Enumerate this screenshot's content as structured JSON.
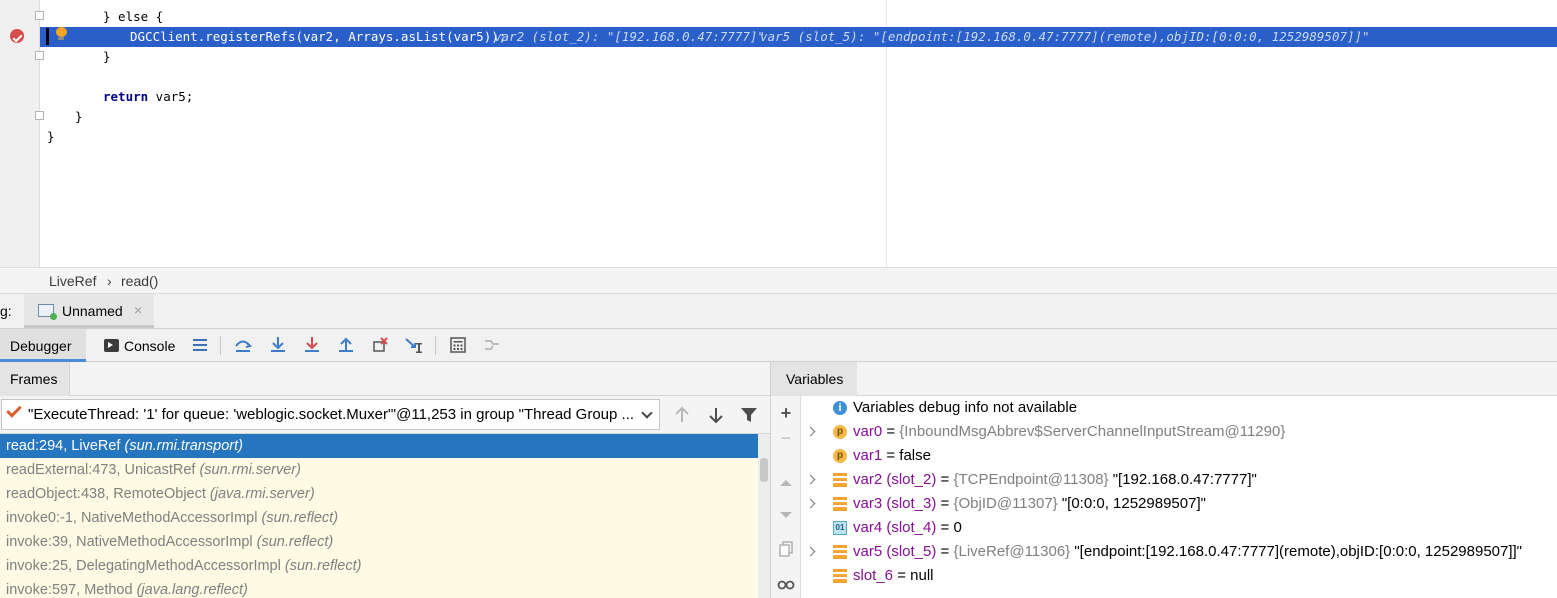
{
  "editor": {
    "lines": {
      "else": "} else {",
      "call": "DGCClient.registerRefs(var2, Arrays.asList(var5));",
      "inline_var2": "var2 (slot_2): \"[192.168.0.47:7777]\"",
      "inline_var5": "var5 (slot_5): \"[endpoint:[192.168.0.47:7777](remote),objID:[0:0:0, 1252989507]]\"",
      "close_else": "}",
      "return_kw": "return",
      "return_rest": " var5;",
      "close_method": "}",
      "close_class": "}"
    }
  },
  "breadcrumb": {
    "class": "LiveRef",
    "sep": "›",
    "method": "read()"
  },
  "debug_tabbar": {
    "label": "g:",
    "session": "Unnamed",
    "close": "×"
  },
  "toolbar": {
    "debugger": "Debugger",
    "console": "Console"
  },
  "frames": {
    "header": "Frames",
    "thread": "\"ExecuteThread: '1' for queue: 'weblogic.socket.Muxer'\"@11,253 in group \"Thread Group ...",
    "items": [
      {
        "loc": "read:294, LiveRef ",
        "pkg": "(sun.rmi.transport)"
      },
      {
        "loc": "readExternal:473, UnicastRef ",
        "pkg": "(sun.rmi.server)"
      },
      {
        "loc": "readObject:438, RemoteObject ",
        "pkg": "(java.rmi.server)"
      },
      {
        "loc": "invoke0:-1, NativeMethodAccessorImpl ",
        "pkg": "(sun.reflect)"
      },
      {
        "loc": "invoke:39, NativeMethodAccessorImpl ",
        "pkg": "(sun.reflect)"
      },
      {
        "loc": "invoke:25, DelegatingMethodAccessorImpl ",
        "pkg": "(sun.reflect)"
      },
      {
        "loc": "invoke:597, Method ",
        "pkg": "(java.lang.reflect)"
      }
    ]
  },
  "variables": {
    "header": "Variables",
    "info": "Variables debug info not available",
    "items": [
      {
        "name": "var0",
        "eq": " = ",
        "type": "{InboundMsgAbbrev$ServerChannelInputStream@11290}",
        "val": ""
      },
      {
        "name": "var1",
        "eq": " = ",
        "type": "",
        "val": "false"
      },
      {
        "name": "var2 (slot_2)",
        "eq": " = ",
        "type": "{TCPEndpoint@11308} ",
        "val": "\"[192.168.0.47:7777]\""
      },
      {
        "name": "var3 (slot_3)",
        "eq": " = ",
        "type": "{ObjID@11307} ",
        "val": "\"[0:0:0, 1252989507]\""
      },
      {
        "name": "var4 (slot_4)",
        "eq": " = ",
        "type": "",
        "val": "0"
      },
      {
        "name": "var5 (slot_5)",
        "eq": " = ",
        "type": "{LiveRef@11306} ",
        "val": "\"[endpoint:[192.168.0.47:7777](remote),objID:[0:0:0, 1252989507]]\""
      },
      {
        "name": "slot_6",
        "eq": " = ",
        "type": "",
        "val": "null"
      }
    ],
    "icon_labels": {
      "p": "p",
      "prim": "01",
      "info": "i"
    }
  },
  "colors": {
    "exec_line": "#2a5fc9",
    "selected_frame": "#2675bf",
    "frame_bg": "#fdfbe3",
    "var_name": "#871094",
    "breakpoint": "#d64d4d"
  }
}
